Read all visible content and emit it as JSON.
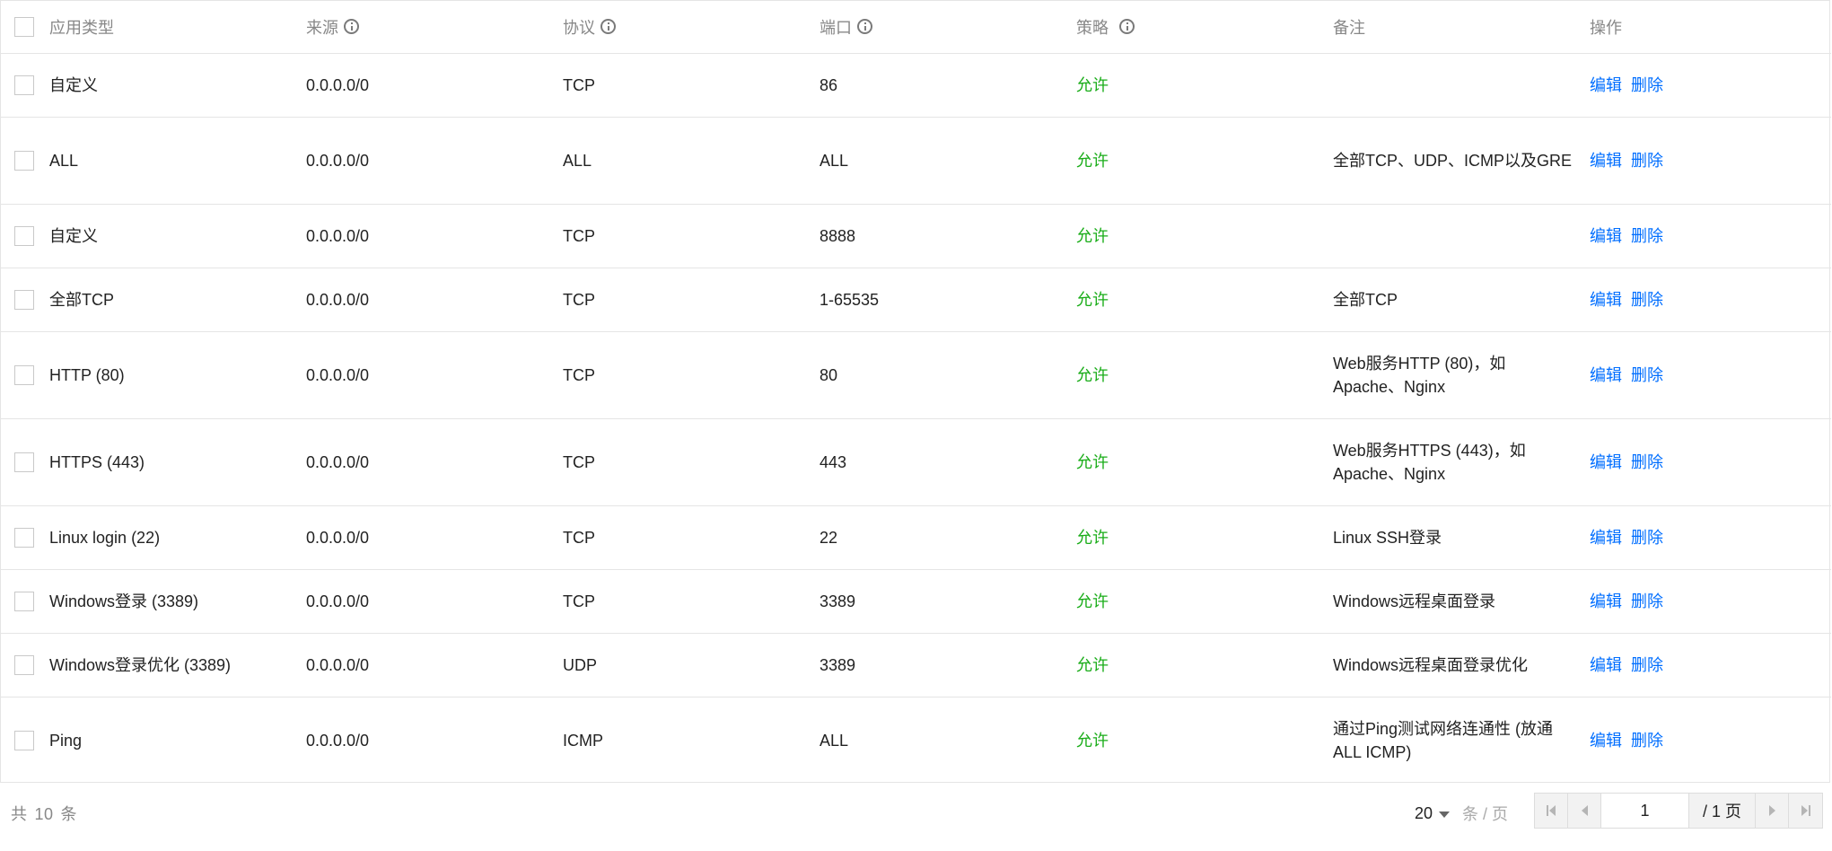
{
  "table": {
    "headers": {
      "type": "应用类型",
      "source": "来源",
      "protocol": "协议",
      "port": "端口",
      "policy": "策略",
      "note": "备注",
      "ops": "操作"
    },
    "rows": [
      {
        "type": "自定义",
        "source": "0.0.0.0/0",
        "protocol": "TCP",
        "port": "86",
        "policy": "允许",
        "note": "",
        "edit": "编辑",
        "delete": "删除"
      },
      {
        "type": "ALL",
        "source": "0.0.0.0/0",
        "protocol": "ALL",
        "port": "ALL",
        "policy": "允许",
        "note": "全部TCP、UDP、ICMP以及GRE",
        "edit": "编辑",
        "delete": "删除"
      },
      {
        "type": "自定义",
        "source": "0.0.0.0/0",
        "protocol": "TCP",
        "port": "8888",
        "policy": "允许",
        "note": "",
        "edit": "编辑",
        "delete": "删除"
      },
      {
        "type": "全部TCP",
        "source": "0.0.0.0/0",
        "protocol": "TCP",
        "port": "1-65535",
        "policy": "允许",
        "note": "全部TCP",
        "edit": "编辑",
        "delete": "删除"
      },
      {
        "type": "HTTP (80)",
        "source": "0.0.0.0/0",
        "protocol": "TCP",
        "port": "80",
        "policy": "允许",
        "note": "Web服务HTTP (80)，如Apache、Nginx",
        "edit": "编辑",
        "delete": "删除"
      },
      {
        "type": "HTTPS (443)",
        "source": "0.0.0.0/0",
        "protocol": "TCP",
        "port": "443",
        "policy": "允许",
        "note": "Web服务HTTPS (443)，如Apache、Nginx",
        "edit": "编辑",
        "delete": "删除"
      },
      {
        "type": "Linux login (22)",
        "source": "0.0.0.0/0",
        "protocol": "TCP",
        "port": "22",
        "policy": "允许",
        "note": "Linux SSH登录",
        "edit": "编辑",
        "delete": "删除"
      },
      {
        "type": "Windows登录 (3389)",
        "source": "0.0.0.0/0",
        "protocol": "TCP",
        "port": "3389",
        "policy": "允许",
        "note": "Windows远程桌面登录",
        "edit": "编辑",
        "delete": "删除"
      },
      {
        "type": "Windows登录优化 (3389)",
        "source": "0.0.0.0/0",
        "protocol": "UDP",
        "port": "3389",
        "policy": "允许",
        "note": "Windows远程桌面登录优化",
        "edit": "编辑",
        "delete": "删除"
      },
      {
        "type": "Ping",
        "source": "0.0.0.0/0",
        "protocol": "ICMP",
        "port": "ALL",
        "policy": "允许",
        "note": "通过Ping测试网络连通性 (放通ALL ICMP)",
        "edit": "编辑",
        "delete": "删除"
      }
    ]
  },
  "footer": {
    "total_prefix": "共",
    "total_count": "10",
    "total_suffix": "条",
    "page_size": "20",
    "per_page_label": "条 / 页",
    "current_page": "1",
    "total_pages": "/ 1 页"
  },
  "colors": {
    "policy_allow": "#1aad19",
    "link": "#006eff",
    "header_text": "#888888"
  },
  "icons": {
    "header_info": "info-circle-icon",
    "page_size_caret": "caret-down-icon",
    "first_page": "first-page-icon",
    "prev_page": "prev-page-icon",
    "next_page": "next-page-icon",
    "last_page": "last-page-icon"
  }
}
